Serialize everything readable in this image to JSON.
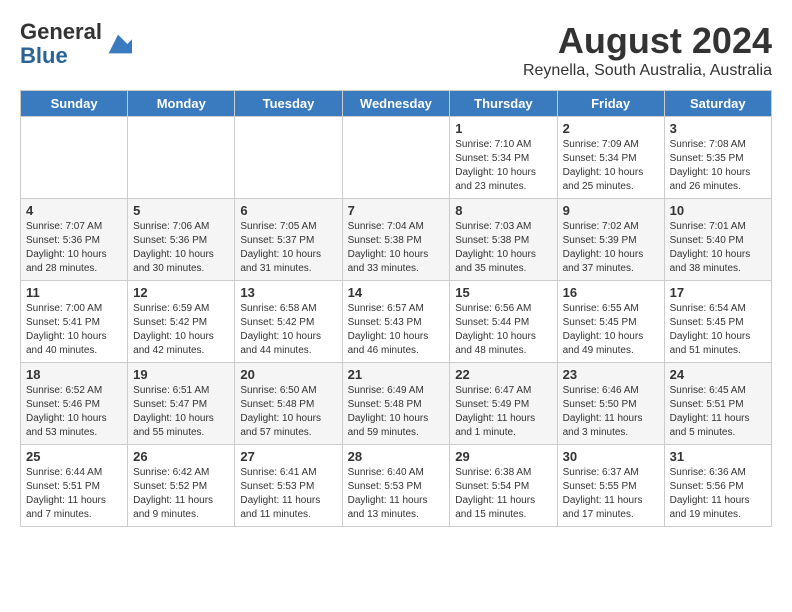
{
  "header": {
    "logo_general": "General",
    "logo_blue": "Blue",
    "month_title": "August 2024",
    "location": "Reynella, South Australia, Australia"
  },
  "weekdays": [
    "Sunday",
    "Monday",
    "Tuesday",
    "Wednesday",
    "Thursday",
    "Friday",
    "Saturday"
  ],
  "weeks": [
    [
      {
        "day": "",
        "info": ""
      },
      {
        "day": "",
        "info": ""
      },
      {
        "day": "",
        "info": ""
      },
      {
        "day": "",
        "info": ""
      },
      {
        "day": "1",
        "info": "Sunrise: 7:10 AM\nSunset: 5:34 PM\nDaylight: 10 hours\nand 23 minutes."
      },
      {
        "day": "2",
        "info": "Sunrise: 7:09 AM\nSunset: 5:34 PM\nDaylight: 10 hours\nand 25 minutes."
      },
      {
        "day": "3",
        "info": "Sunrise: 7:08 AM\nSunset: 5:35 PM\nDaylight: 10 hours\nand 26 minutes."
      }
    ],
    [
      {
        "day": "4",
        "info": "Sunrise: 7:07 AM\nSunset: 5:36 PM\nDaylight: 10 hours\nand 28 minutes."
      },
      {
        "day": "5",
        "info": "Sunrise: 7:06 AM\nSunset: 5:36 PM\nDaylight: 10 hours\nand 30 minutes."
      },
      {
        "day": "6",
        "info": "Sunrise: 7:05 AM\nSunset: 5:37 PM\nDaylight: 10 hours\nand 31 minutes."
      },
      {
        "day": "7",
        "info": "Sunrise: 7:04 AM\nSunset: 5:38 PM\nDaylight: 10 hours\nand 33 minutes."
      },
      {
        "day": "8",
        "info": "Sunrise: 7:03 AM\nSunset: 5:38 PM\nDaylight: 10 hours\nand 35 minutes."
      },
      {
        "day": "9",
        "info": "Sunrise: 7:02 AM\nSunset: 5:39 PM\nDaylight: 10 hours\nand 37 minutes."
      },
      {
        "day": "10",
        "info": "Sunrise: 7:01 AM\nSunset: 5:40 PM\nDaylight: 10 hours\nand 38 minutes."
      }
    ],
    [
      {
        "day": "11",
        "info": "Sunrise: 7:00 AM\nSunset: 5:41 PM\nDaylight: 10 hours\nand 40 minutes."
      },
      {
        "day": "12",
        "info": "Sunrise: 6:59 AM\nSunset: 5:42 PM\nDaylight: 10 hours\nand 42 minutes."
      },
      {
        "day": "13",
        "info": "Sunrise: 6:58 AM\nSunset: 5:42 PM\nDaylight: 10 hours\nand 44 minutes."
      },
      {
        "day": "14",
        "info": "Sunrise: 6:57 AM\nSunset: 5:43 PM\nDaylight: 10 hours\nand 46 minutes."
      },
      {
        "day": "15",
        "info": "Sunrise: 6:56 AM\nSunset: 5:44 PM\nDaylight: 10 hours\nand 48 minutes."
      },
      {
        "day": "16",
        "info": "Sunrise: 6:55 AM\nSunset: 5:45 PM\nDaylight: 10 hours\nand 49 minutes."
      },
      {
        "day": "17",
        "info": "Sunrise: 6:54 AM\nSunset: 5:45 PM\nDaylight: 10 hours\nand 51 minutes."
      }
    ],
    [
      {
        "day": "18",
        "info": "Sunrise: 6:52 AM\nSunset: 5:46 PM\nDaylight: 10 hours\nand 53 minutes."
      },
      {
        "day": "19",
        "info": "Sunrise: 6:51 AM\nSunset: 5:47 PM\nDaylight: 10 hours\nand 55 minutes."
      },
      {
        "day": "20",
        "info": "Sunrise: 6:50 AM\nSunset: 5:48 PM\nDaylight: 10 hours\nand 57 minutes."
      },
      {
        "day": "21",
        "info": "Sunrise: 6:49 AM\nSunset: 5:48 PM\nDaylight: 10 hours\nand 59 minutes."
      },
      {
        "day": "22",
        "info": "Sunrise: 6:47 AM\nSunset: 5:49 PM\nDaylight: 11 hours\nand 1 minute."
      },
      {
        "day": "23",
        "info": "Sunrise: 6:46 AM\nSunset: 5:50 PM\nDaylight: 11 hours\nand 3 minutes."
      },
      {
        "day": "24",
        "info": "Sunrise: 6:45 AM\nSunset: 5:51 PM\nDaylight: 11 hours\nand 5 minutes."
      }
    ],
    [
      {
        "day": "25",
        "info": "Sunrise: 6:44 AM\nSunset: 5:51 PM\nDaylight: 11 hours\nand 7 minutes."
      },
      {
        "day": "26",
        "info": "Sunrise: 6:42 AM\nSunset: 5:52 PM\nDaylight: 11 hours\nand 9 minutes."
      },
      {
        "day": "27",
        "info": "Sunrise: 6:41 AM\nSunset: 5:53 PM\nDaylight: 11 hours\nand 11 minutes."
      },
      {
        "day": "28",
        "info": "Sunrise: 6:40 AM\nSunset: 5:53 PM\nDaylight: 11 hours\nand 13 minutes."
      },
      {
        "day": "29",
        "info": "Sunrise: 6:38 AM\nSunset: 5:54 PM\nDaylight: 11 hours\nand 15 minutes."
      },
      {
        "day": "30",
        "info": "Sunrise: 6:37 AM\nSunset: 5:55 PM\nDaylight: 11 hours\nand 17 minutes."
      },
      {
        "day": "31",
        "info": "Sunrise: 6:36 AM\nSunset: 5:56 PM\nDaylight: 11 hours\nand 19 minutes."
      }
    ]
  ]
}
